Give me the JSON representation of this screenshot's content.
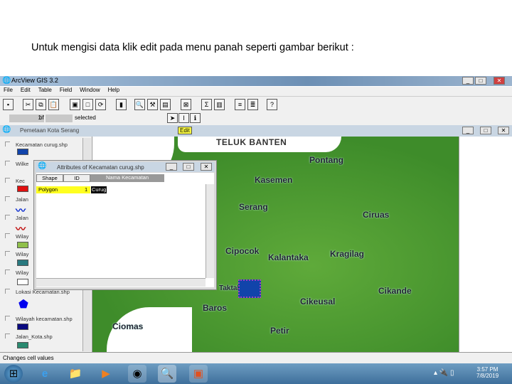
{
  "caption": "Untuk mengisi data klik edit pada menu panah seperti  gambar berikut :",
  "app": {
    "title": "ArcView GIS 3.2",
    "window_buttons": [
      "_",
      "□",
      "✕"
    ]
  },
  "menu": [
    "File",
    "Edit",
    "Table",
    "Field",
    "Window",
    "Help"
  ],
  "selection": {
    "count": "1",
    "of": "of",
    "selected_label": "selected"
  },
  "view": {
    "title": "Pemetaan Kota Serang",
    "edit_tooltip": "Edit"
  },
  "legend": [
    "Kecamatan curug.shp",
    "Wilke",
    "Kec",
    "Jalan",
    "Jalan",
    "Wilay",
    "Wilay",
    "Wilay",
    "Lokasi Kecamatan.shp",
    "Wilayah kecamatan.shp",
    "Jalan_Kota.shp"
  ],
  "legend_colors": [
    "#1144aa",
    "#2266bb",
    "#e01010",
    "#1030d0",
    "#c01010",
    "#8fbf4a",
    "#2a7a80",
    "#ffffff",
    "#0000ee",
    "#0a0a80",
    "#2a8a70"
  ],
  "map_places": [
    "TELUK BANTEN",
    "Pontang",
    "Kasemen",
    "Serang",
    "Ciruas",
    "Cipocok",
    "Kalantaka",
    "Kragilag",
    "Taktakan",
    "Cikande",
    "Cikeusal",
    "Baros",
    "Ciomas",
    "Petir"
  ],
  "dialog": {
    "title": "Attributes of Kecamatan curug.shp",
    "columns": [
      "Shape",
      "ID",
      "Nama Kecamatan"
    ],
    "row": {
      "shape": "Polygon",
      "id": "1",
      "name": "Curug"
    }
  },
  "status": "Changes cell values",
  "taskbar": {
    "time": "3:57 PM",
    "date": "7/8/2019"
  }
}
